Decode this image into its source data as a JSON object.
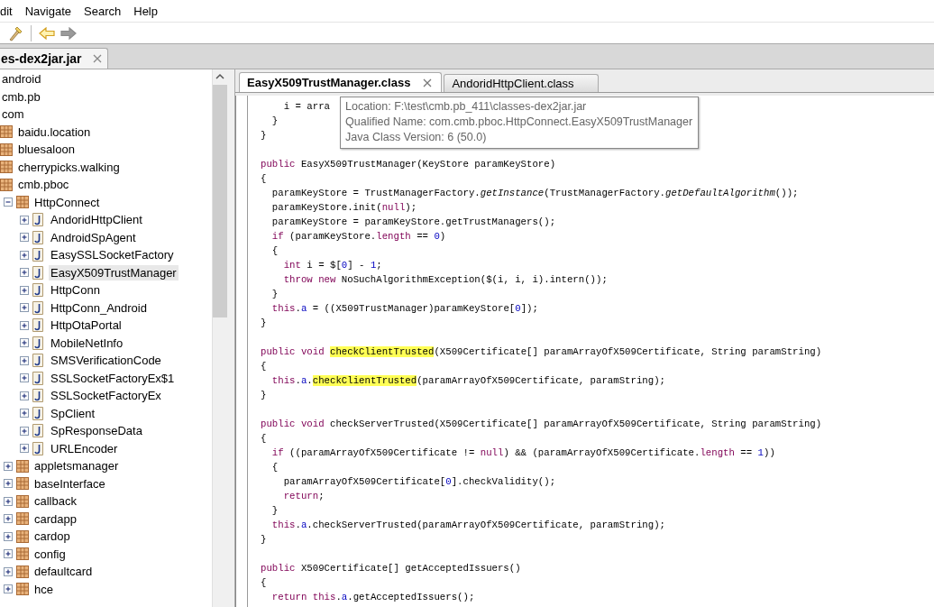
{
  "menu": [
    "dit",
    "Navigate",
    "Search",
    "Help"
  ],
  "toolbar": [
    {
      "kind": "wand",
      "disabled": false
    },
    {
      "kind": "back",
      "disabled": false
    },
    {
      "kind": "forward",
      "disabled": true
    }
  ],
  "file_tabs": [
    {
      "label": "es-dex2jar.jar"
    }
  ],
  "tree": [
    {
      "label": "android",
      "selected": false
    },
    {
      "label": "cmb.pb",
      "selected": false
    },
    {
      "label": "com",
      "selected": false,
      "children": [
        {
          "label": "baidu.location",
          "kind": "package",
          "selected": false
        },
        {
          "label": "bluesaloon",
          "kind": "package",
          "selected": false
        },
        {
          "label": "cherrypicks.walking",
          "kind": "package",
          "selected": false
        },
        {
          "label": "cmb.pboc",
          "kind": "package",
          "selected": false,
          "children": [
            {
              "label": "HttpConnect",
              "kind": "package",
              "expanded": true,
              "selected": false,
              "children": [
                {
                  "label": "AndoridHttpClient",
                  "kind": "class",
                  "expanded": false,
                  "selected": false
                },
                {
                  "label": "AndroidSpAgent",
                  "kind": "class",
                  "expanded": false,
                  "selected": false
                },
                {
                  "label": "EasySSLSocketFactory",
                  "kind": "class",
                  "expanded": false,
                  "selected": false
                },
                {
                  "label": "EasyX509TrustManager",
                  "kind": "class",
                  "expanded": false,
                  "selected": true
                },
                {
                  "label": "HttpConn",
                  "kind": "class",
                  "expanded": false,
                  "selected": false
                },
                {
                  "label": "HttpConn_Android",
                  "kind": "class",
                  "expanded": false,
                  "selected": false
                },
                {
                  "label": "HttpOtaPortal",
                  "kind": "class",
                  "expanded": false,
                  "selected": false
                },
                {
                  "label": "MobileNetInfo",
                  "kind": "class",
                  "expanded": false,
                  "selected": false
                },
                {
                  "label": "SMSVerificationCode",
                  "kind": "class",
                  "expanded": false,
                  "selected": false
                },
                {
                  "label": "SSLSocketFactoryEx$1",
                  "kind": "class",
                  "expanded": false,
                  "selected": false
                },
                {
                  "label": "SSLSocketFactoryEx",
                  "kind": "class",
                  "expanded": false,
                  "selected": false
                },
                {
                  "label": "SpClient",
                  "kind": "class",
                  "expanded": false,
                  "selected": false
                },
                {
                  "label": "SpResponseData",
                  "kind": "class",
                  "expanded": false,
                  "selected": false
                },
                {
                  "label": "URLEncoder",
                  "kind": "class",
                  "expanded": false,
                  "selected": false
                }
              ]
            },
            {
              "label": "appletsmanager",
              "kind": "package",
              "expanded": false,
              "selected": false
            },
            {
              "label": "baseInterface",
              "kind": "package",
              "expanded": false,
              "selected": false
            },
            {
              "label": "callback",
              "kind": "package",
              "expanded": false,
              "selected": false
            },
            {
              "label": "cardapp",
              "kind": "package",
              "expanded": false,
              "selected": false
            },
            {
              "label": "cardop",
              "kind": "package",
              "expanded": false,
              "selected": false
            },
            {
              "label": "config",
              "kind": "package",
              "expanded": false,
              "selected": false
            },
            {
              "label": "defaultcard",
              "kind": "package",
              "expanded": false,
              "selected": false
            },
            {
              "label": "hce",
              "kind": "package",
              "expanded": false,
              "selected": false
            }
          ]
        }
      ]
    }
  ],
  "editor_tabs": [
    {
      "label": "EasyX509TrustManager.class",
      "selected": true
    },
    {
      "label": "AndoridHttpClient.class",
      "selected": false
    }
  ],
  "tooltip": [
    "Location: F:\\test\\cmb.pb_411\\classes-dex2jar.jar",
    "Qualified Name: com.cmb.pboc.HttpConnect.EasyX509TrustManager",
    "Java Class Version: 6 (50.0)"
  ],
  "code": [
    [
      [
        {
          "text": "    i = arra"
        }
      ],
      [
        {
          "text": "  }"
        }
      ],
      [
        {
          "text": "}"
        }
      ]
    ],
    [
      [
        {
          "text": "public",
          "kind": "kw"
        },
        {
          "text": " EasyX509TrustManager(KeyStore paramKeyStore)"
        }
      ],
      [
        {
          "text": "{"
        }
      ],
      [
        {
          "text": "  paramKeyStore = TrustManagerFactory."
        },
        {
          "text": "getInstance",
          "kind": "italic"
        },
        {
          "text": "(TrustManagerFactory."
        },
        {
          "text": "getDefaultAlgorithm",
          "kind": "italic"
        },
        {
          "text": "());"
        }
      ],
      [
        {
          "text": "  paramKeyStore.init("
        },
        {
          "text": "null",
          "kind": "kw"
        },
        {
          "text": ");"
        }
      ],
      [
        {
          "text": "  paramKeyStore = paramKeyStore.getTrustManagers();"
        }
      ],
      [
        {
          "text": "  if",
          "kind": "kw"
        },
        {
          "text": " (paramKeyStore."
        },
        {
          "text": "length",
          "kind": "kw"
        },
        {
          "text": " == "
        },
        {
          "text": "0",
          "kind": "num"
        },
        {
          "text": ")"
        }
      ],
      [
        {
          "text": "  {"
        }
      ],
      [
        {
          "text": "    int",
          "kind": "kw"
        },
        {
          "text": " i = $["
        },
        {
          "text": "0",
          "kind": "num"
        },
        {
          "text": "] - "
        },
        {
          "text": "1",
          "kind": "num"
        },
        {
          "text": ";"
        }
      ],
      [
        {
          "text": "    throw new",
          "kind": "kw"
        },
        {
          "text": " NoSuchAlgorithmException($(i, i, i).intern());"
        }
      ],
      [
        {
          "text": "  }"
        }
      ],
      [
        {
          "text": "  this",
          "kind": "kw"
        },
        {
          "text": "."
        },
        {
          "text": "a",
          "kind": "field"
        },
        {
          "text": " = ((X509TrustManager)paramKeyStore["
        },
        {
          "text": "0",
          "kind": "num"
        },
        {
          "text": "]);"
        }
      ],
      [
        {
          "text": "}"
        }
      ]
    ],
    [
      [
        {
          "text": "public void ",
          "kind": "kw"
        },
        {
          "text": "checkClientTrusted",
          "kind": "match"
        },
        {
          "text": "(X509Certificate[] paramArrayOfX509Certificate, String paramString)"
        }
      ],
      [
        {
          "text": "{"
        }
      ],
      [
        {
          "text": "  this",
          "kind": "kw"
        },
        {
          "text": "."
        },
        {
          "text": "a",
          "kind": "field"
        },
        {
          "text": "."
        },
        {
          "text": "checkClientTrusted",
          "kind": "match"
        },
        {
          "text": "(paramArrayOfX509Certificate, paramString);"
        }
      ],
      [
        {
          "text": "}"
        }
      ]
    ],
    [
      [
        {
          "text": "public void",
          "kind": "kw"
        },
        {
          "text": " checkServerTrusted(X509Certificate[] paramArrayOfX509Certificate, String paramString)"
        }
      ],
      [
        {
          "text": "{"
        }
      ],
      [
        {
          "text": "  if",
          "kind": "kw"
        },
        {
          "text": " ((paramArrayOfX509Certificate != "
        },
        {
          "text": "null",
          "kind": "kw"
        },
        {
          "text": ") && (paramArrayOfX509Certificate."
        },
        {
          "text": "length",
          "kind": "kw"
        },
        {
          "text": " == "
        },
        {
          "text": "1",
          "kind": "num"
        },
        {
          "text": "))"
        }
      ],
      [
        {
          "text": "  {"
        }
      ],
      [
        {
          "text": "    paramArrayOfX509Certificate["
        },
        {
          "text": "0",
          "kind": "num"
        },
        {
          "text": "].checkValidity();"
        }
      ],
      [
        {
          "text": "    return",
          "kind": "kw"
        },
        {
          "text": ";"
        }
      ],
      [
        {
          "text": "  }"
        }
      ],
      [
        {
          "text": "  this",
          "kind": "kw"
        },
        {
          "text": "."
        },
        {
          "text": "a",
          "kind": "field"
        },
        {
          "text": ".checkServerTrusted(paramArrayOfX509Certificate, paramString);"
        }
      ],
      [
        {
          "text": "}"
        }
      ]
    ],
    [
      [
        {
          "text": "public",
          "kind": "kw"
        },
        {
          "text": " X509Certificate[] getAcceptedIssuers()"
        }
      ],
      [
        {
          "text": "{"
        }
      ],
      [
        {
          "text": "  return this",
          "kind": "kw"
        },
        {
          "text": "."
        },
        {
          "text": "a",
          "kind": "field"
        },
        {
          "text": ".getAcceptedIssuers();"
        }
      ]
    ]
  ]
}
